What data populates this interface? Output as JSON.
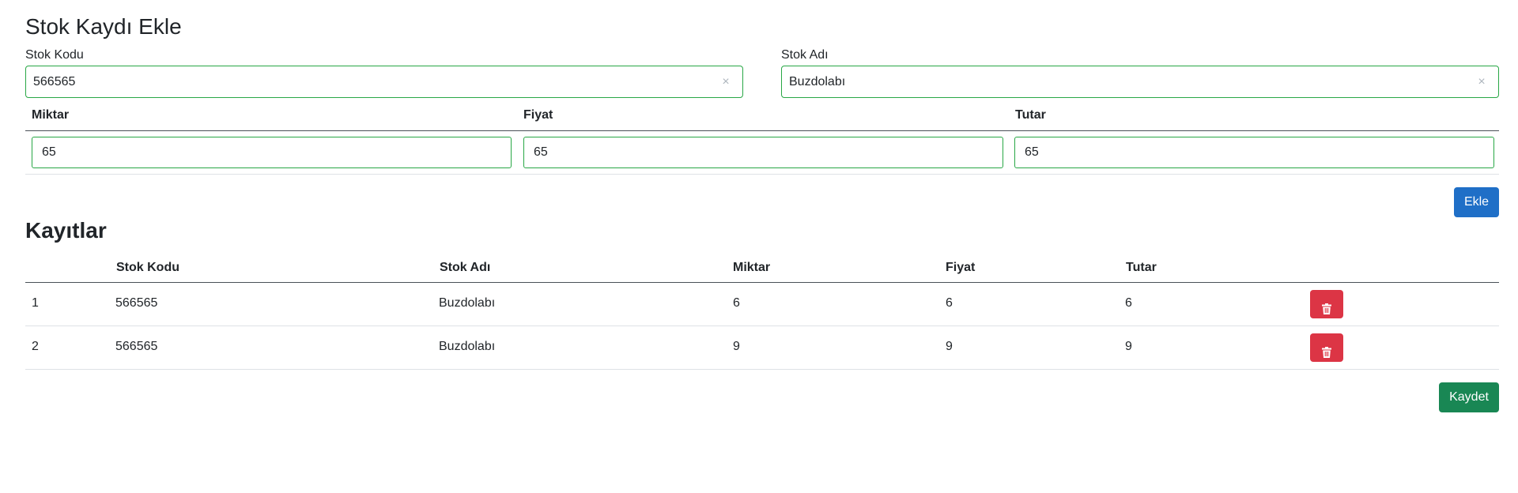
{
  "form": {
    "title": "Stok Kaydı Ekle",
    "stok_kodu": {
      "label": "Stok Kodu",
      "value": "566565",
      "clear_icon": "×"
    },
    "stok_adi": {
      "label": "Stok Adı",
      "value": "Buzdolabı",
      "clear_icon": "×"
    }
  },
  "entry_table": {
    "headers": [
      "Miktar",
      "Fiyat",
      "Tutar"
    ],
    "values": [
      "65",
      "65",
      "65"
    ]
  },
  "buttons": {
    "add": "Ekle",
    "save": "Kaydet"
  },
  "records": {
    "title": "Kayıtlar",
    "headers": [
      "",
      "Stok Kodu",
      "Stok Adı",
      "Miktar",
      "Fiyat",
      "Tutar",
      ""
    ],
    "rows": [
      {
        "no": "1",
        "kod": "566565",
        "ad": "Buzdolabı",
        "miktar": "6",
        "fiyat": "6",
        "tutar": "6"
      },
      {
        "no": "2",
        "kod": "566565",
        "ad": "Buzdolabı",
        "miktar": "9",
        "fiyat": "9",
        "tutar": "9"
      }
    ]
  },
  "colors": {
    "valid_border": "#28a745",
    "primary": "#1f6fc7",
    "success": "#198754",
    "danger": "#dc3545"
  },
  "icons": {
    "delete": "trash-icon",
    "clear": "close-icon"
  }
}
